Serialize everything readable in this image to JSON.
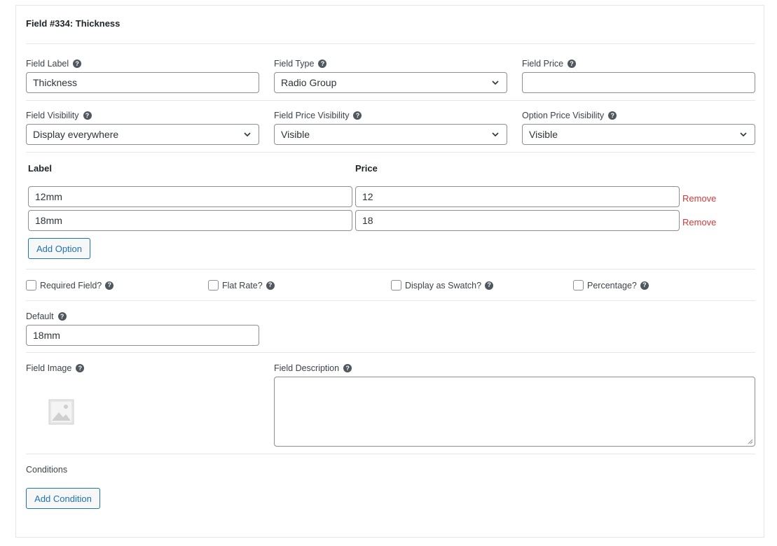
{
  "field": {
    "title": "Field #334: Thickness",
    "label_title": "Field Label",
    "label_value": "Thickness",
    "type_title": "Field Type",
    "type_value": "Radio Group",
    "price_title": "Field Price",
    "price_value": "",
    "visibility_title": "Field Visibility",
    "visibility_value": "Display everywhere",
    "price_visibility_title": "Field Price Visibility",
    "price_visibility_value": "Visible",
    "option_price_visibility_title": "Option Price Visibility",
    "option_price_visibility_value": "Visible"
  },
  "options": {
    "label_header": "Label",
    "price_header": "Price",
    "rows": [
      {
        "label": "12mm",
        "price": "12",
        "remove": "Remove"
      },
      {
        "label": "18mm",
        "price": "18",
        "remove": "Remove"
      }
    ],
    "add_label": "Add Option"
  },
  "checkboxes": [
    {
      "label": "Required Field?",
      "checked": false
    },
    {
      "label": "Flat Rate?",
      "checked": false
    },
    {
      "label": "Display as Swatch?",
      "checked": false
    },
    {
      "label": "Percentage?",
      "checked": false
    }
  ],
  "default": {
    "title": "Default",
    "value": "18mm"
  },
  "image": {
    "title": "Field Image"
  },
  "description": {
    "title": "Field Description",
    "value": ""
  },
  "conditions": {
    "title": "Conditions",
    "add_label": "Add Condition"
  },
  "icons": {
    "help": "question-circle-icon",
    "chevron": "chevron-down-icon",
    "placeholder": "image-placeholder-icon"
  },
  "colors": {
    "accent": "#2271b1",
    "danger": "#d63638",
    "border": "#8c8f94"
  }
}
